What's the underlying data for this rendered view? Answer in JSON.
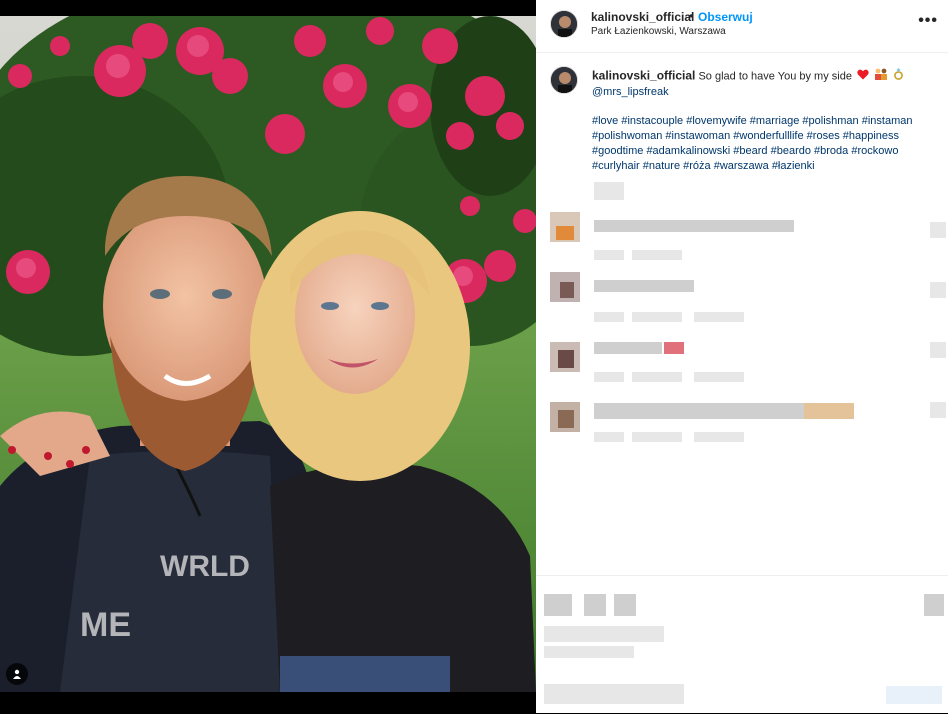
{
  "header": {
    "username": "kalinovski_official",
    "separator": "•",
    "follow_label": "Obserwuj",
    "location": "Park Łazienkowski, Warszawa",
    "more_label": "•••"
  },
  "caption": {
    "username": "kalinovski_official",
    "text": "So glad to have You by my side",
    "mention": "@mrs_lipsfreak",
    "hashtags": [
      "#love",
      "#instacouple",
      "#lovemywife",
      "#marriage",
      "#polishman",
      "#instaman",
      "#polishwoman",
      "#instawoman",
      "#wonderfulllife",
      "#roses",
      "#happiness",
      "#goodtime",
      "#adamkalinowski",
      "#beard",
      "#beardo",
      "#broda",
      "#rockowo",
      "#curlyhair",
      "#nature",
      "#róża",
      "#warszawa",
      "#łazienki"
    ]
  },
  "icons": {
    "tag": "user-tag-icon",
    "heart": "heart-icon",
    "couple": "couple-icon",
    "ring": "ring-icon",
    "more": "more-options-icon"
  },
  "colors": {
    "follow": "#0095f6",
    "link": "#00376b",
    "text": "#262626",
    "heart": "#ed4956"
  }
}
